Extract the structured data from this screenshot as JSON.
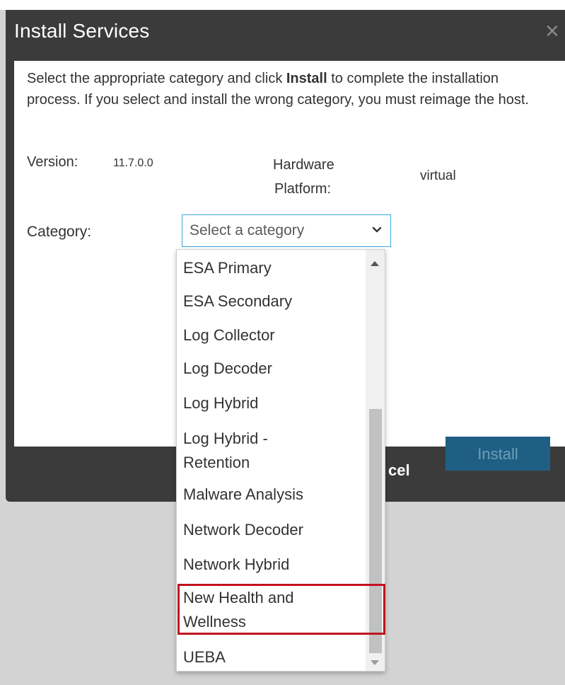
{
  "dialog": {
    "title": "Install Services",
    "close_glyph": "×",
    "intro_pre": "Select the appropriate category and click ",
    "intro_bold": "Install",
    "intro_post": " to complete the installation process. If you select and install the wrong category, you must reimage the host.",
    "version_label": "Version:",
    "version_value": "11.7.0.0",
    "hardware_label_line1": "Hardware",
    "hardware_label_line2": "Platform:",
    "hardware_value": "virtual",
    "category_label": "Category:",
    "category_placeholder": "Select a category",
    "cancel_label_visible": "cel",
    "install_label": "Install"
  },
  "dropdown": {
    "options": [
      "ESA Primary",
      "ESA Secondary",
      "Log Collector",
      "Log Decoder",
      "Log Hybrid",
      "Log Hybrid - Retention",
      "Malware Analysis",
      "Network Decoder",
      "Network Hybrid",
      "New Health and Wellness",
      "UEBA"
    ],
    "highlighted_option": "New Health and Wellness",
    "option_line1": {
      "log_hybrid_retention": "Log Hybrid -",
      "new_health": "New Health and"
    },
    "option_line2": {
      "log_hybrid_retention": "Retention",
      "new_health": "Wellness"
    }
  },
  "colors": {
    "dialog_bg": "#3b3b3b",
    "select_border": "#3ba6d9",
    "install_button": "#1f5f84",
    "highlight": "#c0141f"
  },
  "icons": {
    "close": "close-icon",
    "select_chevron": "chevron-down-icon",
    "scroll_up": "scroll-up-icon",
    "scroll_down": "scroll-down-icon"
  }
}
